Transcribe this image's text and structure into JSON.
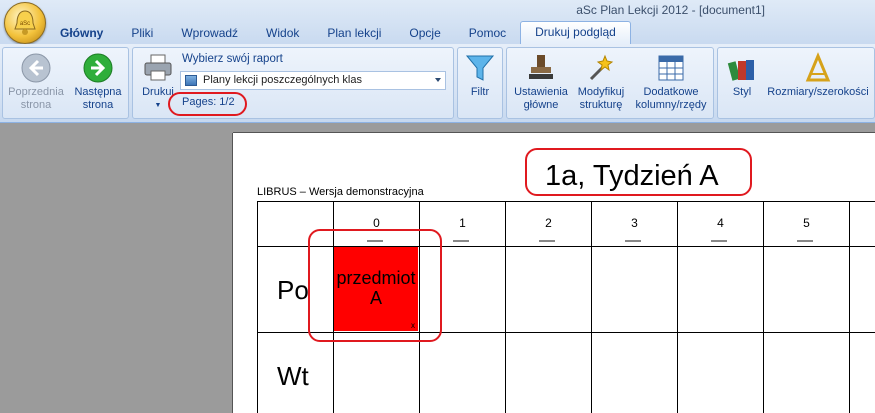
{
  "window": {
    "title": "aSc Plan Lekcji 2012  - [document1]",
    "logo_text": "aSc"
  },
  "tabs": [
    {
      "label": "Główny"
    },
    {
      "label": "Pliki"
    },
    {
      "label": "Wprowadź"
    },
    {
      "label": "Widok"
    },
    {
      "label": "Plan lekcji"
    },
    {
      "label": "Opcje"
    },
    {
      "label": "Pomoc"
    },
    {
      "label": "Drukuj podgląd"
    }
  ],
  "ribbon": {
    "prev_page": {
      "line1": "Poprzednia",
      "line2": "strona"
    },
    "next_page": {
      "line1": "Następna",
      "line2": "strona"
    },
    "print": {
      "label": "Drukuj"
    },
    "report_label": "Wybierz swój raport",
    "report_selected": "Plany lekcji poszczególnych klas",
    "pages": "Pages: 1/2",
    "filter": {
      "label": "Filtr"
    },
    "main_settings": {
      "line1": "Ustawienia",
      "line2": "główne"
    },
    "modify_structure": {
      "line1": "Modyfikuj",
      "line2": "strukturę"
    },
    "extra_cols": {
      "line1": "Dodatkowe",
      "line2": "kolumny/rzędy"
    },
    "style": {
      "label": "Styl"
    },
    "sizes": {
      "label": "Rozmiary/szerokości"
    }
  },
  "document": {
    "title": "1a, Tydzień A",
    "subtitle": "LIBRUS – Wersja demonstracyjna",
    "periods": [
      "0",
      "1",
      "2",
      "3",
      "4",
      "5"
    ],
    "days": [
      "Po",
      "Wt"
    ],
    "lesson": {
      "line1": "przedmiot",
      "line2": "A",
      "mark": "x",
      "color": "#ff0000"
    }
  },
  "colors": {
    "highlight": "#e0191f",
    "tab_text": "#15428b",
    "ribbon_border": "#8db2e3"
  }
}
